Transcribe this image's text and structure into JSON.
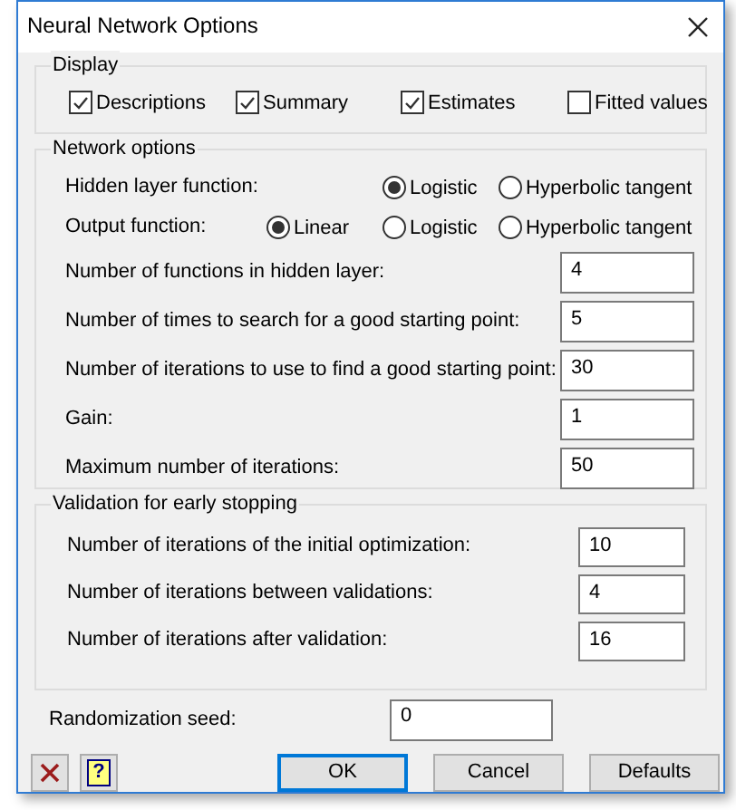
{
  "window": {
    "title": "Neural Network Options"
  },
  "display": {
    "title": "Display",
    "options": [
      {
        "label": "Descriptions",
        "checked": true
      },
      {
        "label": "Summary",
        "checked": true
      },
      {
        "label": "Estimates",
        "checked": true
      },
      {
        "label": "Fitted values",
        "checked": false
      }
    ]
  },
  "network_options": {
    "title": "Network options",
    "radio_rows": [
      {
        "label": "Hidden layer function:",
        "options": [
          {
            "label": "Logistic",
            "selected": true
          },
          {
            "label": "Hyperbolic tangent",
            "selected": false
          }
        ]
      },
      {
        "label": "Output function:",
        "options": [
          {
            "label": "Linear",
            "selected": true
          },
          {
            "label": "Logistic",
            "selected": false
          },
          {
            "label": "Hyperbolic tangent",
            "selected": false
          }
        ]
      }
    ],
    "fields": [
      {
        "label": "Number of functions in hidden layer:",
        "value": "4"
      },
      {
        "label": "Number of times to search for a good starting point:",
        "value": "5"
      },
      {
        "label": "Number of iterations to use to find a good starting point:",
        "value": "30"
      },
      {
        "label": "Gain:",
        "value": "1"
      },
      {
        "label": "Maximum number of iterations:",
        "value": "50"
      }
    ]
  },
  "validation": {
    "title": "Validation for early stopping",
    "fields": [
      {
        "label": "Number of iterations of the initial optimization:",
        "value": "10"
      },
      {
        "label": "Number of iterations between validations:",
        "value": "4"
      },
      {
        "label": "Number of iterations after validation:",
        "value": "16"
      }
    ]
  },
  "seed": {
    "label": "Randomization seed:",
    "value": "0"
  },
  "buttons": [
    "OK",
    "Cancel",
    "Defaults"
  ],
  "help_button": {
    "label": "?"
  }
}
